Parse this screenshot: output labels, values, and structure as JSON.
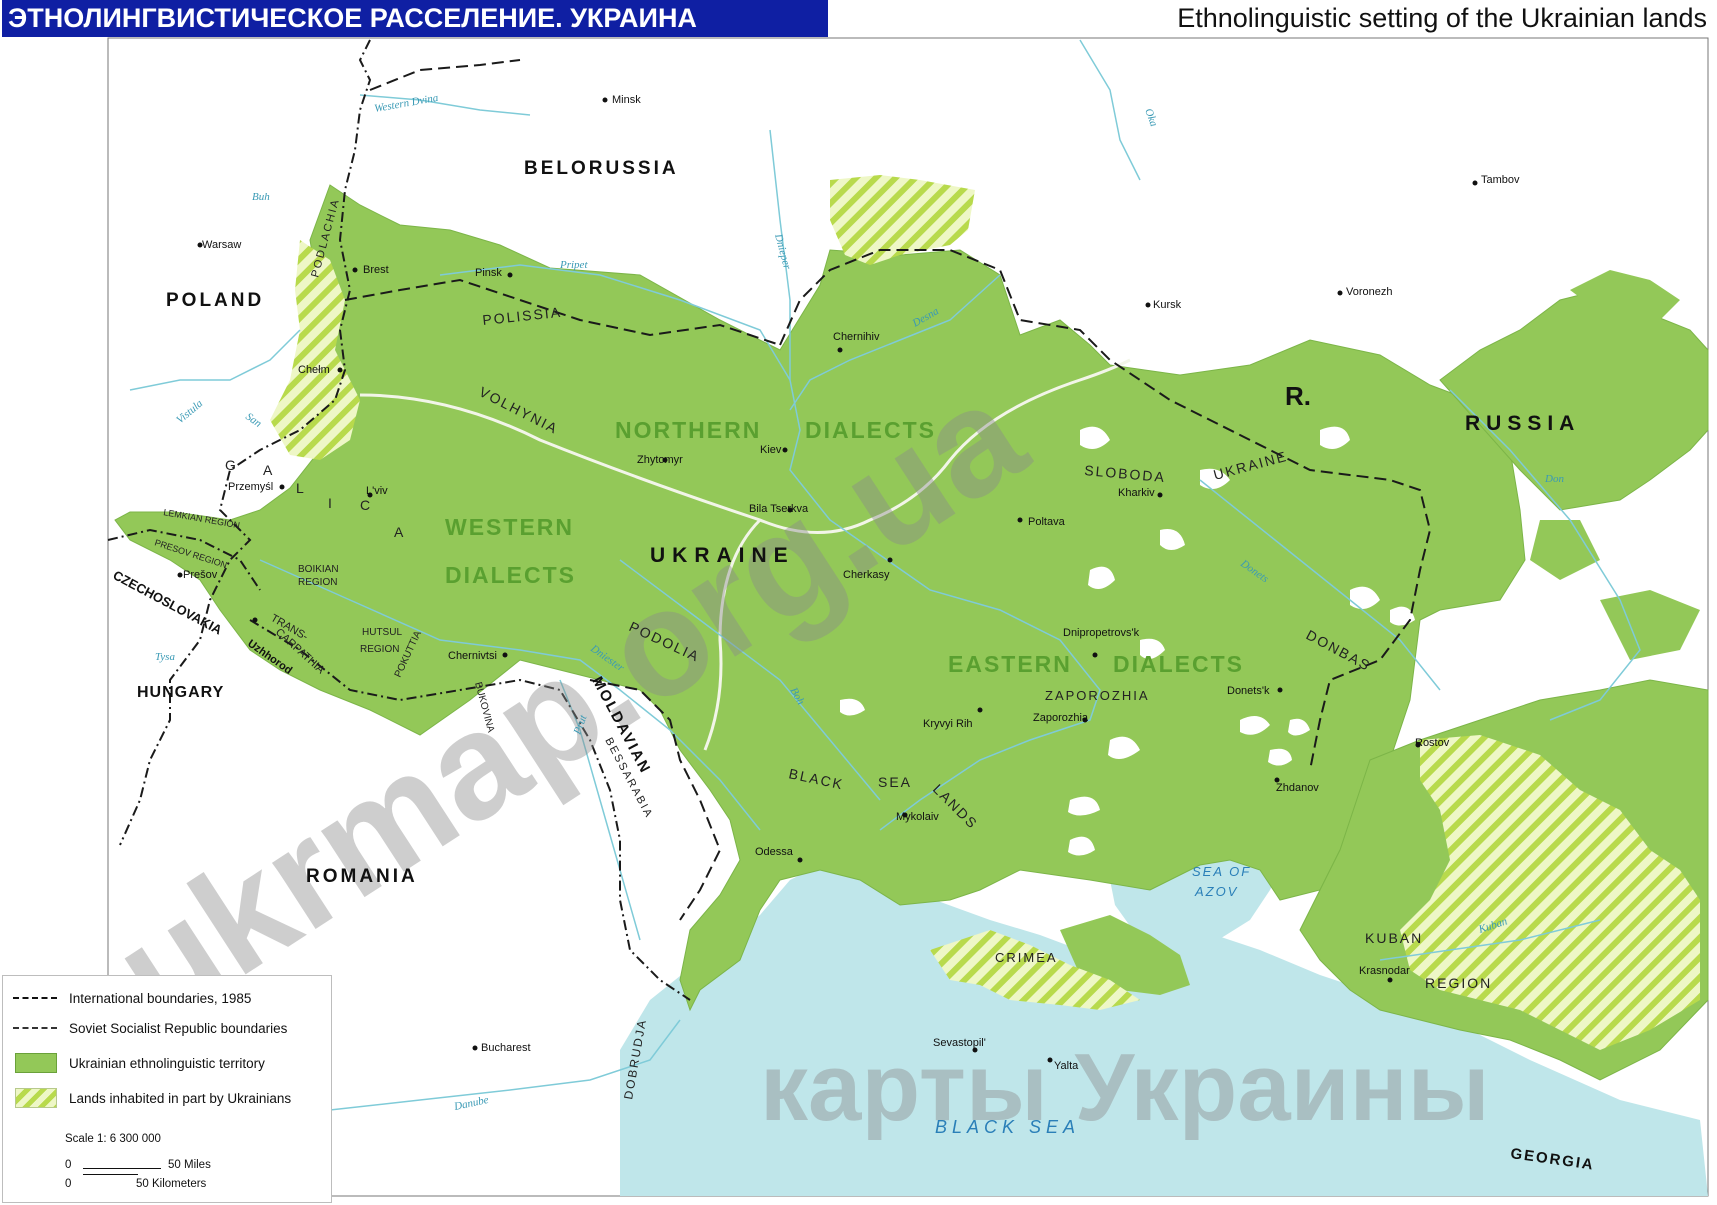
{
  "header": {
    "title_ru": "ЭТНОЛИНГВИСТИЧЕСКОЕ РАССЕЛЕНИЕ. УКРАИНА",
    "title_en": "Ethnolinguistic setting of the Ukrainian lands"
  },
  "colors": {
    "ukrainian_territory": "#93c858",
    "mixed_hatch_light": "#eef7c6",
    "mixed_hatch_dark": "#b8da4c",
    "water": "#bfe6ea",
    "title_bar": "#0f1fa3",
    "dialect_label": "#5aa030"
  },
  "countries": {
    "belorussia": "BELORUSSIA",
    "poland": "POLAND",
    "czechoslovakia": "CZECHOSLOVAKIA",
    "hungary": "HUNGARY",
    "romania": "ROMANIA",
    "russia": "RUSSIA",
    "russia_abbr": "R.",
    "georgia": "GEORGIA",
    "ukraine": "UKRAINE",
    "moldavian": "MOLDAVIAN"
  },
  "dialects": {
    "northern_1": "NORTHERN",
    "northern_2": "DIALECTS",
    "western_1": "WESTERN",
    "western_2": "DIALECTS",
    "eastern_1": "EASTERN",
    "eastern_2": "DIALECTS"
  },
  "regions": {
    "podlachia": "PODLACHIA",
    "polissia": "POLISSIA",
    "volhynia": "VOLHYNIA",
    "galicia_g": "G",
    "galicia_a": "A",
    "galicia_l": "L",
    "galicia_i": "I",
    "galicia_c": "C",
    "galicia_i2": "I",
    "galicia_a2": "A",
    "lemkian_region": "LEMKIAN REGION",
    "presov_region": "PRESOV REGION",
    "boikian_region_1": "BOIKIAN",
    "boikian_region_2": "REGION",
    "hutsul_region_1": "HUTSUL",
    "hutsul_region_2": "REGION",
    "transcarpathia_1": "TRANS-",
    "transcarpathia_2": "CARPATHIA",
    "pokuttia": "POKUTTIA",
    "bukovina": "BUKOVINA",
    "podolia": "PODOLIA",
    "bessarabia": "BESSARABIA",
    "black_sea_lands_1": "BLACK",
    "black_sea_lands_2": "SEA",
    "black_sea_lands_3": "LANDS",
    "sloboda": "SLOBODA",
    "ukraine_sloboda": "UKRAINE",
    "zaporozhia": "ZAPOROZHIA",
    "donbas": "DONBAS",
    "crimea": "CRIMEA",
    "kuban": "KUBAN",
    "kuban_region": "REGION",
    "dobrudja": "DOBRUDJA"
  },
  "seas": {
    "sea_of_azov_1": "SEA OF",
    "sea_of_azov_2": "AZOV",
    "black_sea": "BLACK SEA"
  },
  "rivers": {
    "western_dvina": "Western Dvina",
    "bug": "Buh",
    "pripet": "Pripet",
    "dnieper": "Dnieper",
    "desna": "Desna",
    "oka": "Oka",
    "don": "Don",
    "donets": "Donets",
    "vistula": "Vistula",
    "san": "San",
    "tysa": "Tysa",
    "dniester": "Dniester",
    "boh": "Boh",
    "prut": "Prut",
    "danube": "Danube",
    "kuban_river": "Kuban"
  },
  "cities": {
    "minsk": "Minsk",
    "warsaw": "Warsaw",
    "brest": "Brest",
    "pinsk": "Pinsk",
    "chelm": "Chełm",
    "przemysl": "Przemyśl",
    "lviv": "L'viv",
    "presov": "Prešov",
    "uzhhorod": "Uzhhorod",
    "chernivtsi": "Chernivtsi",
    "zhytomyr": "Zhytomyr",
    "kiev": "Kiev",
    "chernihiv": "Chernihiv",
    "bila_tserkva": "Bila Tserkva",
    "cherkasy": "Cherkasy",
    "poltava": "Poltava",
    "kharkiv": "Kharkiv",
    "kursk": "Kursk",
    "voronezh": "Voronezh",
    "tambov": "Tambov",
    "dnipropetrovsk": "Dnipropetrovs'k",
    "zaporozhia_city": "Zaporozhia",
    "kryvyi_rih": "Kryvyi Rih",
    "donetsk": "Donets'k",
    "mykolaiv": "Mykolaiv",
    "odessa": "Odessa",
    "zhdanov": "Zhdanov",
    "rostov": "Rostov",
    "krasnodar": "Krasnodar",
    "sevastopil": "Sevastopil'",
    "yalta": "Yalta",
    "bucharest": "Bucharest"
  },
  "watermark": {
    "site": "ukrmap.org.ua",
    "caption": "карты Украины"
  },
  "legend": {
    "international_boundaries": "International boundaries, 1985",
    "ssr_boundaries": "Soviet Socialist Republic boundaries",
    "ukrainian_territory": "Ukrainian ethnolinguistic territory",
    "lands_inhabited": "Lands inhabited in part by Ukrainians",
    "scale": "Scale 1: 6 300 000",
    "zero_miles": "0",
    "zero_km": "0",
    "miles": "50 Miles",
    "kilometers": "50 Kilometers"
  }
}
